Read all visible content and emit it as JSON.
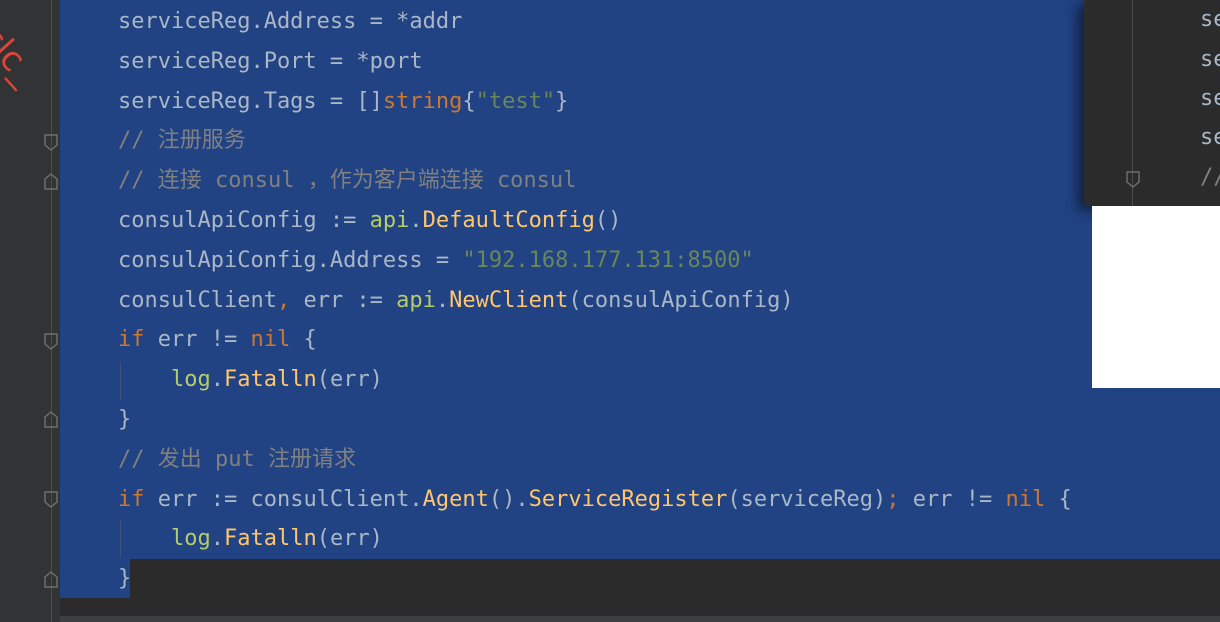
{
  "editor": {
    "watermark_glyphs": "clc_",
    "lines": [
      {
        "tokens": [
          {
            "t": "serviceReg.Address = *addr",
            "c": "default"
          }
        ]
      },
      {
        "tokens": [
          {
            "t": "serviceReg.Port = *port",
            "c": "default"
          }
        ]
      },
      {
        "tokens": [
          {
            "t": "serviceReg.Tags = []",
            "c": "default"
          },
          {
            "t": "string",
            "c": "kw"
          },
          {
            "t": "{",
            "c": "default"
          },
          {
            "t": "\"test\"",
            "c": "str"
          },
          {
            "t": "}",
            "c": "default"
          }
        ]
      },
      {
        "tokens": [
          {
            "t": "// 注册服务",
            "c": "cm"
          }
        ]
      },
      {
        "tokens": [
          {
            "t": "// 连接 consul ，作为客户端连接 consul",
            "c": "cm"
          }
        ]
      },
      {
        "tokens": [
          {
            "t": "consulApiConfig := ",
            "c": "default"
          },
          {
            "t": "api",
            "c": "pkg"
          },
          {
            "t": ".",
            "c": "default"
          },
          {
            "t": "DefaultConfig",
            "c": "fn"
          },
          {
            "t": "()",
            "c": "default"
          }
        ]
      },
      {
        "tokens": [
          {
            "t": "consulApiConfig.Address = ",
            "c": "default"
          },
          {
            "t": "\"192.168.177.131:8500\"",
            "c": "str"
          }
        ]
      },
      {
        "tokens": [
          {
            "t": "consulClient",
            "c": "default"
          },
          {
            "t": ",",
            "c": "kw"
          },
          {
            "t": " err := ",
            "c": "default"
          },
          {
            "t": "api",
            "c": "pkg"
          },
          {
            "t": ".",
            "c": "default"
          },
          {
            "t": "NewClient",
            "c": "fn"
          },
          {
            "t": "(consulApiConfig)",
            "c": "default"
          }
        ]
      },
      {
        "tokens": [
          {
            "t": "if",
            "c": "kw"
          },
          {
            "t": " err != ",
            "c": "default"
          },
          {
            "t": "nil",
            "c": "kw"
          },
          {
            "t": " {",
            "c": "default"
          }
        ]
      },
      {
        "tokens": [
          {
            "t": "    ",
            "c": "default"
          },
          {
            "t": "log",
            "c": "pkg"
          },
          {
            "t": ".",
            "c": "default"
          },
          {
            "t": "Fatalln",
            "c": "fn"
          },
          {
            "t": "(err)",
            "c": "default"
          }
        ]
      },
      {
        "tokens": [
          {
            "t": "}",
            "c": "default"
          }
        ]
      },
      {
        "tokens": [
          {
            "t": "// 发出 put 注册请求",
            "c": "cm"
          }
        ]
      },
      {
        "tokens": [
          {
            "t": "if",
            "c": "kw"
          },
          {
            "t": " err := consulClient.",
            "c": "default"
          },
          {
            "t": "Agent",
            "c": "fn"
          },
          {
            "t": "().",
            "c": "default"
          },
          {
            "t": "ServiceRegister",
            "c": "fn"
          },
          {
            "t": "(serviceReg)",
            "c": "default"
          },
          {
            "t": ";",
            "c": "kw"
          },
          {
            "t": " err != ",
            "c": "default"
          },
          {
            "t": "nil",
            "c": "kw"
          },
          {
            "t": " {",
            "c": "default"
          }
        ]
      },
      {
        "tokens": [
          {
            "t": "    ",
            "c": "default"
          },
          {
            "t": "log",
            "c": "pkg"
          },
          {
            "t": ".",
            "c": "default"
          },
          {
            "t": "Fatalln",
            "c": "fn"
          },
          {
            "t": "(err)",
            "c": "default"
          }
        ]
      },
      {
        "tokens": [
          {
            "t": "}",
            "c": "default"
          }
        ]
      }
    ]
  },
  "popup": {
    "lines": [
      "se",
      "se",
      "se",
      "se",
      "//"
    ]
  }
}
